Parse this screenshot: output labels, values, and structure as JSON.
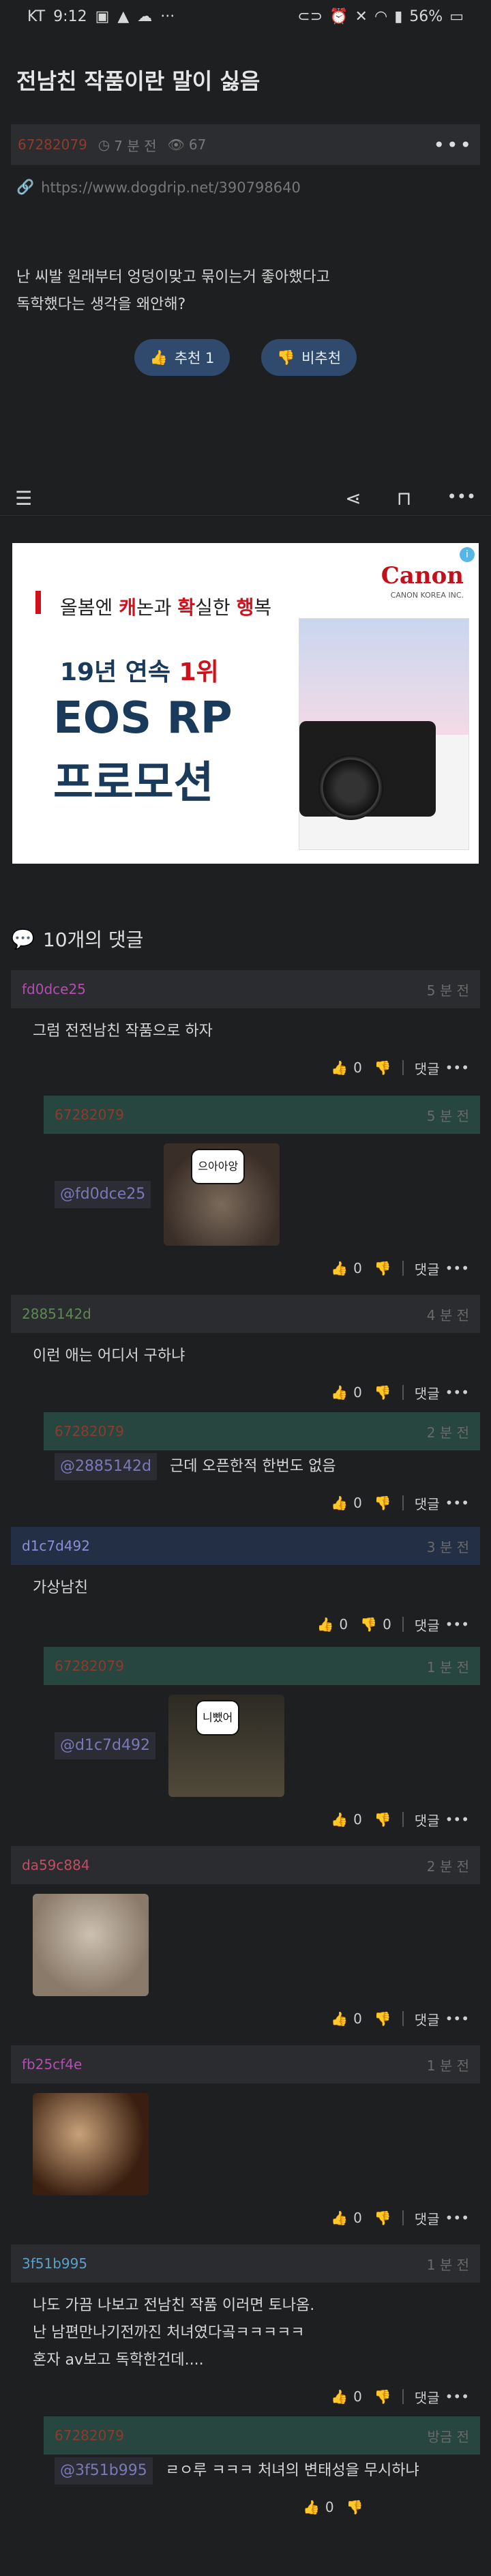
{
  "status_bar": {
    "carrier": "KT",
    "time": "9:12",
    "battery": "56%"
  },
  "post": {
    "title": "전남친 작품이란 말이 싫음",
    "author": "67282079",
    "time_ago": "7 분 전",
    "views": "67",
    "url": "https://www.dogdrip.net/390798640",
    "body_lines": [
      "난 씨발 원래부터 엉덩이맞고 묶이는거 좋아했다고",
      "독학했다는 생각을 왜안해?"
    ],
    "upvote_label": "추천 1",
    "downvote_label": "비추천"
  },
  "ad": {
    "slogan_1": "올봄엔 ",
    "slogan_2": "캐",
    "slogan_3": "논과 ",
    "slogan_4": "확",
    "slogan_5": "실한 ",
    "slogan_6": "행",
    "slogan_7": "복",
    "years_1": "19년 연속 ",
    "years_2": "1위",
    "line_1": "EOS RP",
    "line_2": "프로모션",
    "brand": "Canon",
    "brand_sub": "CANON KOREA INC."
  },
  "comments_title": "10개의 댓글",
  "comments": [
    {
      "author": "fd0dce25",
      "author_color": "#b24fb0",
      "time": "5 분 전",
      "text": "그럼 전전남친 작품으로 하자",
      "likes": "0",
      "reply_label": "댓글"
    },
    {
      "author": "67282079",
      "author_color": "#8f3b2c",
      "time": "5 분 전",
      "mention": "@fd0dce25",
      "image_caption": "으아아앙",
      "likes": "0",
      "reply_label": "댓글"
    },
    {
      "author": "2885142d",
      "author_color": "#5d8a54",
      "time": "4 분 전",
      "text": "이런 애는 어디서 구하냐",
      "likes": "0",
      "reply_label": "댓글"
    },
    {
      "author": "67282079",
      "author_color": "#8f3b2c",
      "time": "2 분 전",
      "mention": "@2885142d",
      "text": "근데 오픈한적 한번도 없음",
      "likes": "0",
      "reply_label": "댓글"
    },
    {
      "author": "d1c7d492",
      "author_color": "#6e6eae",
      "time": "3 분 전",
      "text": "가상남친",
      "likes": "0",
      "dislikes": "0",
      "reply_label": "댓글"
    },
    {
      "author": "67282079",
      "author_color": "#8f3b2c",
      "time": "1 분 전",
      "mention": "@d1c7d492",
      "image_caption": "니뺐어",
      "likes": "0",
      "reply_label": "댓글"
    },
    {
      "author": "da59c884",
      "author_color": "#c04f66",
      "time": "2 분 전",
      "likes": "0",
      "reply_label": "댓글"
    },
    {
      "author": "fb25cf4e",
      "author_color": "#b24fb0",
      "time": "1 분 전",
      "likes": "0",
      "reply_label": "댓글"
    },
    {
      "author": "3f51b995",
      "author_color": "#5aa0c9",
      "time": "1 분 전",
      "text_lines": [
        "나도 가끔 나보고 전남친 작품 이러면 토나옴.",
        "난 남편만나기전까진 처녀였다곸ㅋㅋㅋㅋㅋ",
        "혼자 av보고 독학한건데...."
      ],
      "likes": "0",
      "reply_label": "댓글"
    },
    {
      "author": "67282079",
      "author_color": "#8f3b2c",
      "time": "방금 전",
      "mention": "@3f51b995",
      "text": "ㄹㅇ루 ㅋㅋㅋ 처녀의 변태성을 무시하냐",
      "likes": "0"
    }
  ]
}
